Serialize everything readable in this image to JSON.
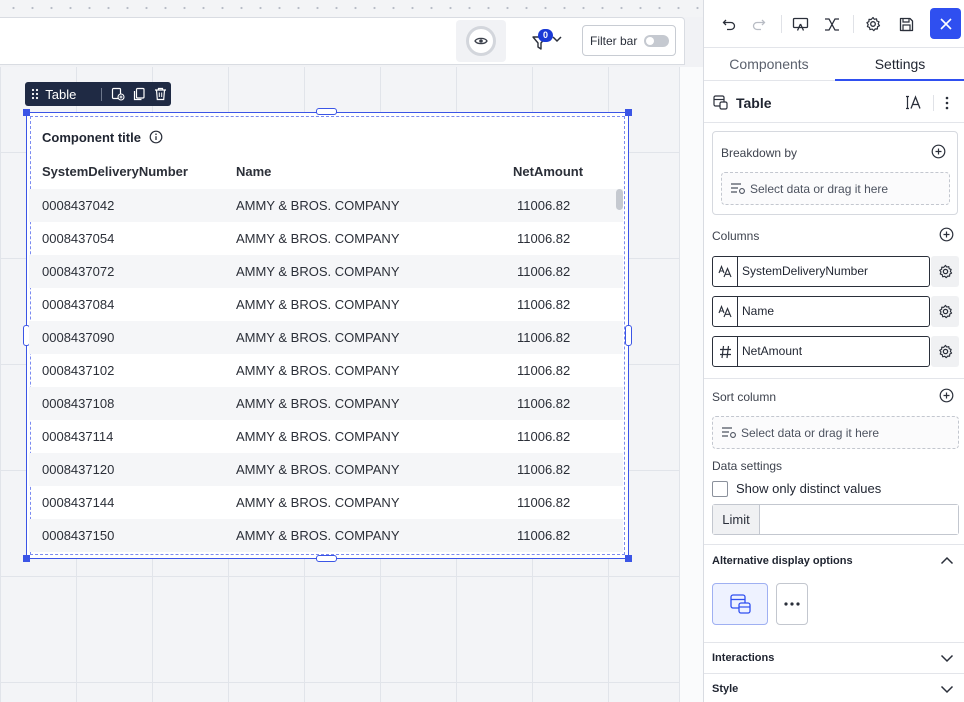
{
  "topbar": {
    "filter_count": "0",
    "filter_bar_label": "Filter bar"
  },
  "component": {
    "toolbar_label": "Table",
    "title": "Component title",
    "columns": [
      "SystemDeliveryNumber",
      "Name",
      "NetAmount"
    ],
    "rows": [
      [
        "0008437042",
        "AMMY & BROS. COMPANY",
        "11006.82"
      ],
      [
        "0008437054",
        "AMMY & BROS. COMPANY",
        "11006.82"
      ],
      [
        "0008437072",
        "AMMY & BROS. COMPANY",
        "11006.82"
      ],
      [
        "0008437084",
        "AMMY & BROS. COMPANY",
        "11006.82"
      ],
      [
        "0008437090",
        "AMMY & BROS. COMPANY",
        "11006.82"
      ],
      [
        "0008437102",
        "AMMY & BROS. COMPANY",
        "11006.82"
      ],
      [
        "0008437108",
        "AMMY & BROS. COMPANY",
        "11006.82"
      ],
      [
        "0008437114",
        "AMMY & BROS. COMPANY",
        "11006.82"
      ],
      [
        "0008437120",
        "AMMY & BROS. COMPANY",
        "11006.82"
      ],
      [
        "0008437144",
        "AMMY & BROS. COMPANY",
        "11006.82"
      ],
      [
        "0008437150",
        "AMMY & BROS. COMPANY",
        "11006.82"
      ]
    ]
  },
  "panel": {
    "tabs": [
      "Components",
      "Settings"
    ],
    "active_tab": "Settings",
    "header_title": "Table",
    "breakdown_label": "Breakdown by",
    "breakdown_placeholder": "Select data or drag it here",
    "columns_label": "Columns",
    "columns": [
      {
        "type_icon": "text-type-icon",
        "name": "SystemDeliveryNumber"
      },
      {
        "type_icon": "text-type-icon",
        "name": "Name"
      },
      {
        "type_icon": "number-type-icon",
        "name": "NetAmount"
      }
    ],
    "sort_label": "Sort column",
    "sort_placeholder": "Select data or drag it here",
    "data_settings_label": "Data settings",
    "distinct_label": "Show only distinct values",
    "distinct_checked": false,
    "limit_label": "Limit",
    "limit_value": "",
    "alt_display_label": "Alternative display options",
    "interactions_label": "Interactions",
    "style_label": "Style"
  },
  "colors": {
    "accent": "#2f4ff0",
    "selection": "#3b55e6",
    "toolbar_bg": "#1f2a44"
  }
}
